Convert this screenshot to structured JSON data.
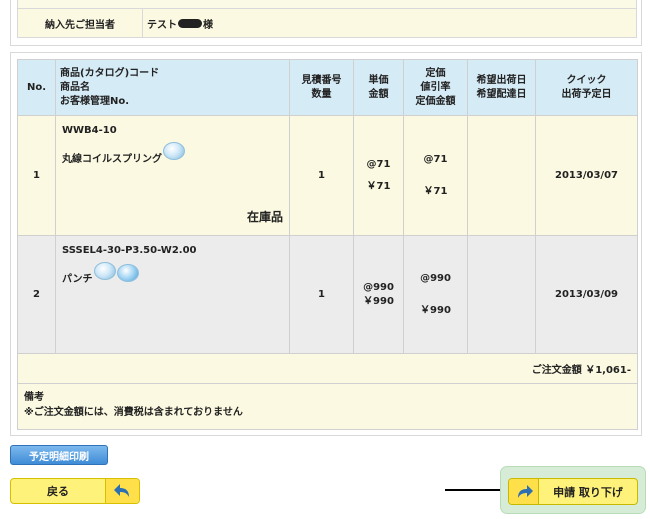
{
  "recipient": {
    "label": "納入先ご担当者",
    "value_prefix": "テスト",
    "value_suffix": "様"
  },
  "table": {
    "headers": {
      "no": "No.",
      "product_line1": "商品(カタログ)コード",
      "product_line2": "商品名",
      "product_line3": "お客様管理No.",
      "quote_line1": "見積番号",
      "quote_line2": "数量",
      "unit_line1": "単価",
      "unit_line2": "金額",
      "list_line1": "定価",
      "list_line2": "値引率",
      "list_line3": "定価金額",
      "hope_line1": "希望出荷日",
      "hope_line2": "希望配達日",
      "quick_line1": "クイック",
      "quick_line2": "出荷予定日"
    },
    "rows": [
      {
        "no": "1",
        "code": "WWB4-10",
        "name": "丸線コイルスプリング",
        "stock": "在庫品",
        "quantity": "1",
        "unit_price": "@71",
        "amount": "￥71",
        "list_price": "@71",
        "list_amount": "￥71",
        "ship_date": "2013/03/07"
      },
      {
        "no": "2",
        "code": "SSSEL4-30-P3.50-W2.00",
        "name": "パンチ",
        "stock": "",
        "quantity": "1",
        "unit_price": "@990",
        "amount": "￥990",
        "list_price": "@990",
        "list_amount": "￥990",
        "ship_date": "2013/03/09"
      }
    ],
    "total_text": "ご注文金額 ￥1,061-",
    "notes_title": "備考",
    "notes_text": "※ご注文金額には、消費税は含まれておりません"
  },
  "buttons": {
    "print": "予定明細印刷",
    "back": "戻る",
    "cancel": "申請 取り下げ"
  },
  "colors": {
    "header_bg": "#d5ebf6",
    "row_yellow": "#fbf9e1",
    "row_gray": "#ececec",
    "button_yellow": "#fff27a",
    "print_blue": "#3f8cd6"
  }
}
